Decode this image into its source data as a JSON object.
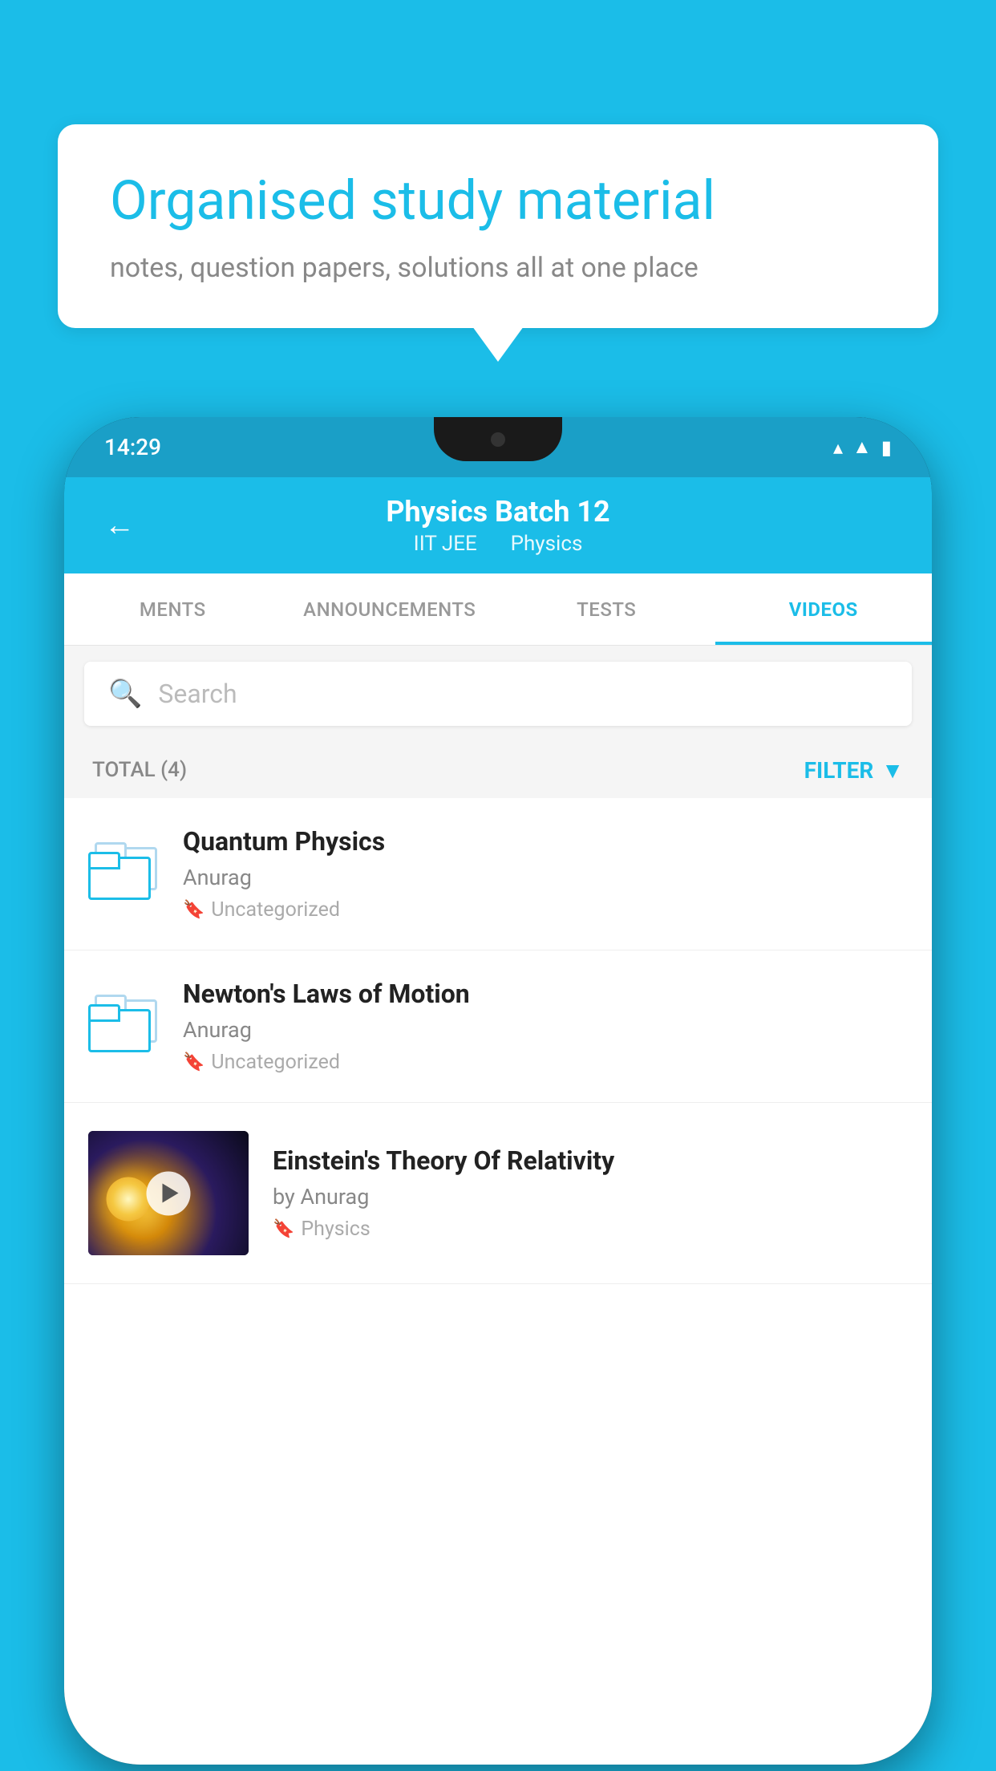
{
  "background_color": "#1bbde8",
  "speech_bubble": {
    "title": "Organised study material",
    "subtitle": "notes, question papers, solutions all at one place"
  },
  "phone": {
    "status_bar": {
      "time": "14:29",
      "icons": [
        "wifi",
        "signal",
        "battery"
      ]
    },
    "header": {
      "title": "Physics Batch 12",
      "subtitle_part1": "IIT JEE",
      "subtitle_part2": "Physics",
      "back_label": "←"
    },
    "tabs": [
      {
        "label": "MENTS",
        "active": false
      },
      {
        "label": "ANNOUNCEMENTS",
        "active": false
      },
      {
        "label": "TESTS",
        "active": false
      },
      {
        "label": "VIDEOS",
        "active": true
      }
    ],
    "search": {
      "placeholder": "Search"
    },
    "filter_bar": {
      "total_label": "TOTAL (4)",
      "filter_label": "FILTER"
    },
    "videos": [
      {
        "title": "Quantum Physics",
        "author": "Anurag",
        "tag": "Uncategorized",
        "type": "folder"
      },
      {
        "title": "Newton's Laws of Motion",
        "author": "Anurag",
        "tag": "Uncategorized",
        "type": "folder"
      },
      {
        "title": "Einstein's Theory Of Relativity",
        "author": "by Anurag",
        "tag": "Physics",
        "type": "video"
      }
    ]
  }
}
